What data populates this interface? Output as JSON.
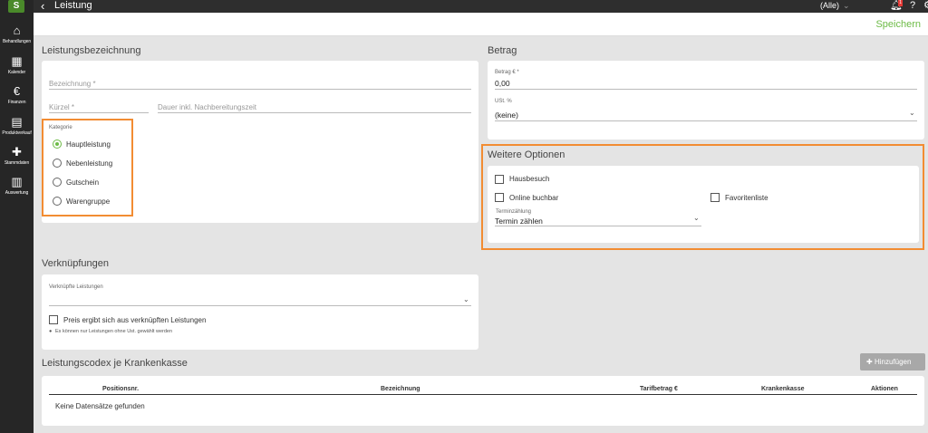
{
  "sidebar": {
    "logo": "S",
    "items": [
      {
        "icon": "home-icon",
        "glyph": "⌂",
        "label": "Behandlungen"
      },
      {
        "icon": "calendar-icon",
        "glyph": "▦",
        "label": "Kalender"
      },
      {
        "icon": "euro-icon",
        "glyph": "€",
        "label": "Finanzen"
      },
      {
        "icon": "document-icon",
        "glyph": "▤",
        "label": "Produktverkauf"
      },
      {
        "icon": "puzzle-icon",
        "glyph": "✚",
        "label": "Stammdaten"
      },
      {
        "icon": "bar-chart-icon",
        "glyph": "▥",
        "label": "Auswertung"
      }
    ]
  },
  "topbar": {
    "title": "Leistung",
    "filter": "(Alle)",
    "notification_count": "1"
  },
  "save_label": "Speichern",
  "leistungsbezeichnung": {
    "title": "Leistungsbezeichnung",
    "bezeichnung_placeholder": "Bezeichnung *",
    "kuerzel_placeholder": "Kürzel *",
    "dauer_placeholder": "Dauer inkl. Nachbereitungszeit",
    "kategorie_label": "Kategorie",
    "kategorien": [
      "Hauptleistung",
      "Nebenleistung",
      "Gutschein",
      "Warengruppe"
    ],
    "selected_index": 0
  },
  "betrag": {
    "title": "Betrag",
    "betrag_label": "Betrag € *",
    "betrag_value": "0,00",
    "ust_label": "USt. %",
    "ust_value": "(keine)"
  },
  "weitere_optionen": {
    "title": "Weitere Optionen",
    "hausbesuch": "Hausbesuch",
    "online_buchbar": "Online buchbar",
    "favoritenliste": "Favoritenliste",
    "terminzaehlung_label": "Terminzählung",
    "terminzaehlung_value": "Termin zählen"
  },
  "verknuepfungen": {
    "title": "Verknüpfungen",
    "verknuepfte_label": "Verknüpfte Leistungen",
    "preis_checkbox": "Preis ergibt sich aus verknüpften Leistungen",
    "hint": "Es können nur Leistungen ohne Ust. gewählt werden"
  },
  "codex": {
    "title": "Leistungscodex je Krankenkasse",
    "add_label": "Hinzufügen",
    "columns": [
      "Positionsnr.",
      "Bezeichnung",
      "Tarifbetrag €",
      "Krankenkasse",
      "Aktionen"
    ],
    "empty": "Keine Datensätze gefunden"
  },
  "colors": {
    "accent_green": "#6dbb46",
    "highlight_orange": "#f28c32",
    "topbar": "#2e2e2e"
  }
}
